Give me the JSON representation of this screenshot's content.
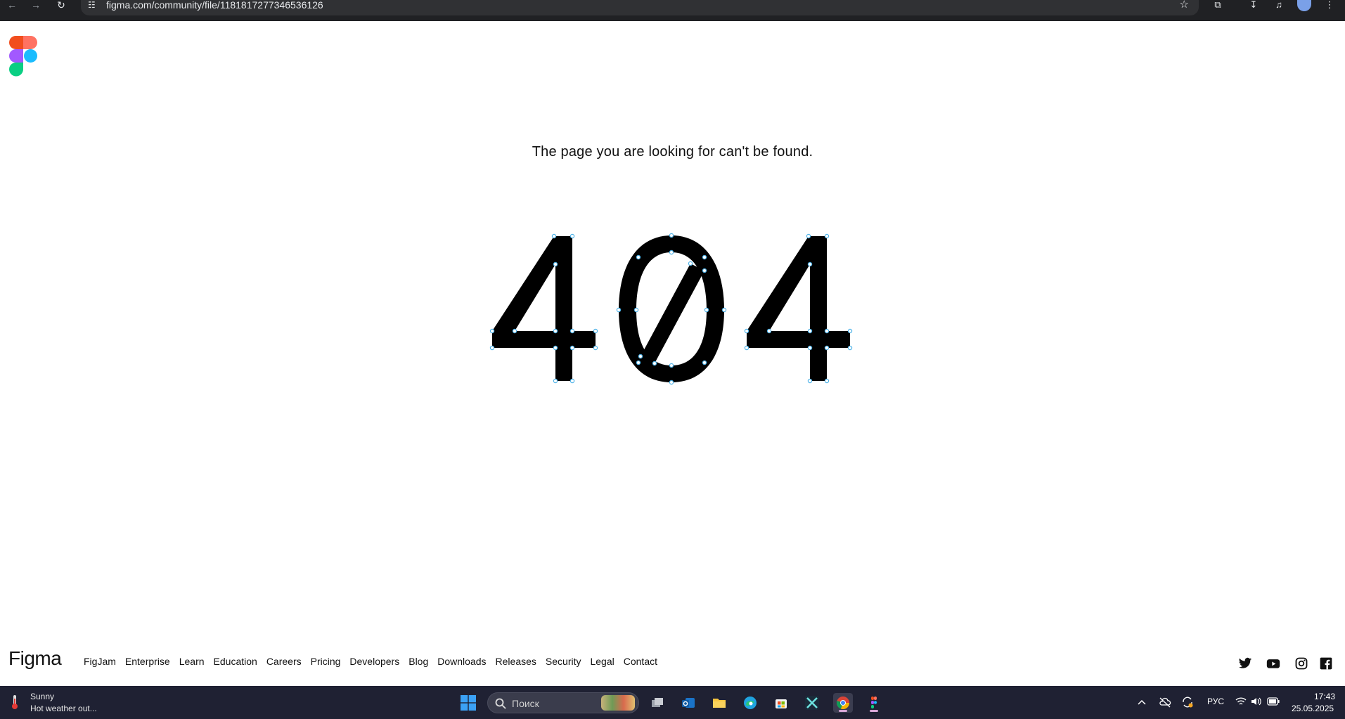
{
  "browser": {
    "url": "figma.com/community/file/1181817277346536126"
  },
  "page": {
    "message": "The page you are looking for can't be found.",
    "error_code": "404"
  },
  "footer": {
    "logo_text": "Figma",
    "links": [
      "FigJam",
      "Enterprise",
      "Learn",
      "Education",
      "Careers",
      "Pricing",
      "Developers",
      "Blog",
      "Downloads",
      "Releases",
      "Security",
      "Legal",
      "Contact"
    ],
    "social_icons": [
      "twitter-icon",
      "youtube-icon",
      "instagram-icon",
      "facebook-icon"
    ]
  },
  "taskbar": {
    "weather_title": "Sunny",
    "weather_subtitle": "Hot weather out...",
    "search_placeholder": "Поиск",
    "language": "РУС",
    "time": "17:43",
    "date": "25.05.2025"
  },
  "colors": {
    "figma_red": "#f24e1e",
    "figma_orange": "#ff7262",
    "figma_purple": "#a259ff",
    "figma_blue": "#1abcfe",
    "figma_green": "#0acf83",
    "handle_blue": "#4fb3e8",
    "taskbar_bg": "#1f2133"
  }
}
